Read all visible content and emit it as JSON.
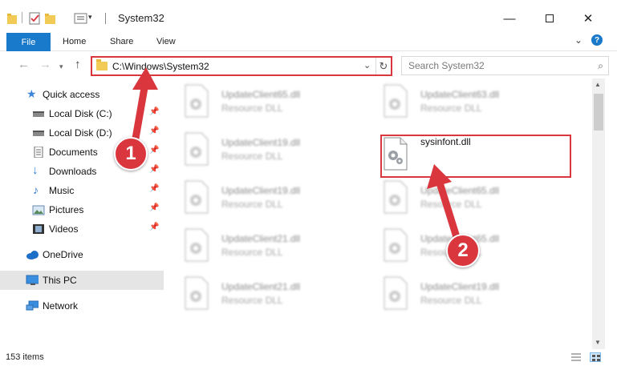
{
  "window": {
    "title": "System32",
    "minimize_icon": "minimize-icon",
    "maximize_icon": "maximize-icon",
    "close_icon": "close-icon"
  },
  "ribbon": {
    "tabs": [
      "File",
      "Home",
      "Share",
      "View"
    ],
    "help": "?"
  },
  "nav": {
    "address": "C:\\Windows\\System32",
    "search_placeholder": "Search System32"
  },
  "sidebar": {
    "items": [
      {
        "label": "Quick access",
        "icon": "star-icon"
      },
      {
        "label": "Local Disk (C:)",
        "icon": "drive-icon"
      },
      {
        "label": "Local Disk (D:)",
        "icon": "drive-icon"
      },
      {
        "label": "Documents",
        "icon": "documents-icon"
      },
      {
        "label": "Downloads",
        "icon": "download-icon"
      },
      {
        "label": "Music",
        "icon": "music-icon"
      },
      {
        "label": "Pictures",
        "icon": "pictures-icon"
      },
      {
        "label": "Videos",
        "icon": "videos-icon"
      },
      {
        "label": "OneDrive",
        "icon": "cloud-icon"
      },
      {
        "label": "This PC",
        "icon": "computer-icon"
      },
      {
        "label": "Network",
        "icon": "network-icon"
      }
    ]
  },
  "files": [
    {
      "name": "UpdateClient65.dll",
      "type": "Resource DLL"
    },
    {
      "name": "UpdateClient63.dll",
      "type": "Resource DLL"
    },
    {
      "name": "UpdateClient19.dll",
      "type": "Resource DLL"
    },
    {
      "name": "sysinfont.dll",
      "type": ""
    },
    {
      "name": "UpdateClient19.dll",
      "type": "Resource DLL"
    },
    {
      "name": "UpdateClient65.dll",
      "type": "Resource DLL"
    },
    {
      "name": "UpdateClient21.dll",
      "type": "Resource DLL"
    },
    {
      "name": "UpdateClient65.dll",
      "type": "Resource DLL"
    },
    {
      "name": "UpdateClient21.dll",
      "type": "Resource DLL"
    },
    {
      "name": "UpdateClient19.dll",
      "type": "Resource DLL"
    }
  ],
  "status": {
    "count": "153 items"
  },
  "annotations": {
    "step1": "1",
    "step2": "2"
  },
  "colors": {
    "accent": "#1979ca",
    "highlight": "#d9363e"
  }
}
